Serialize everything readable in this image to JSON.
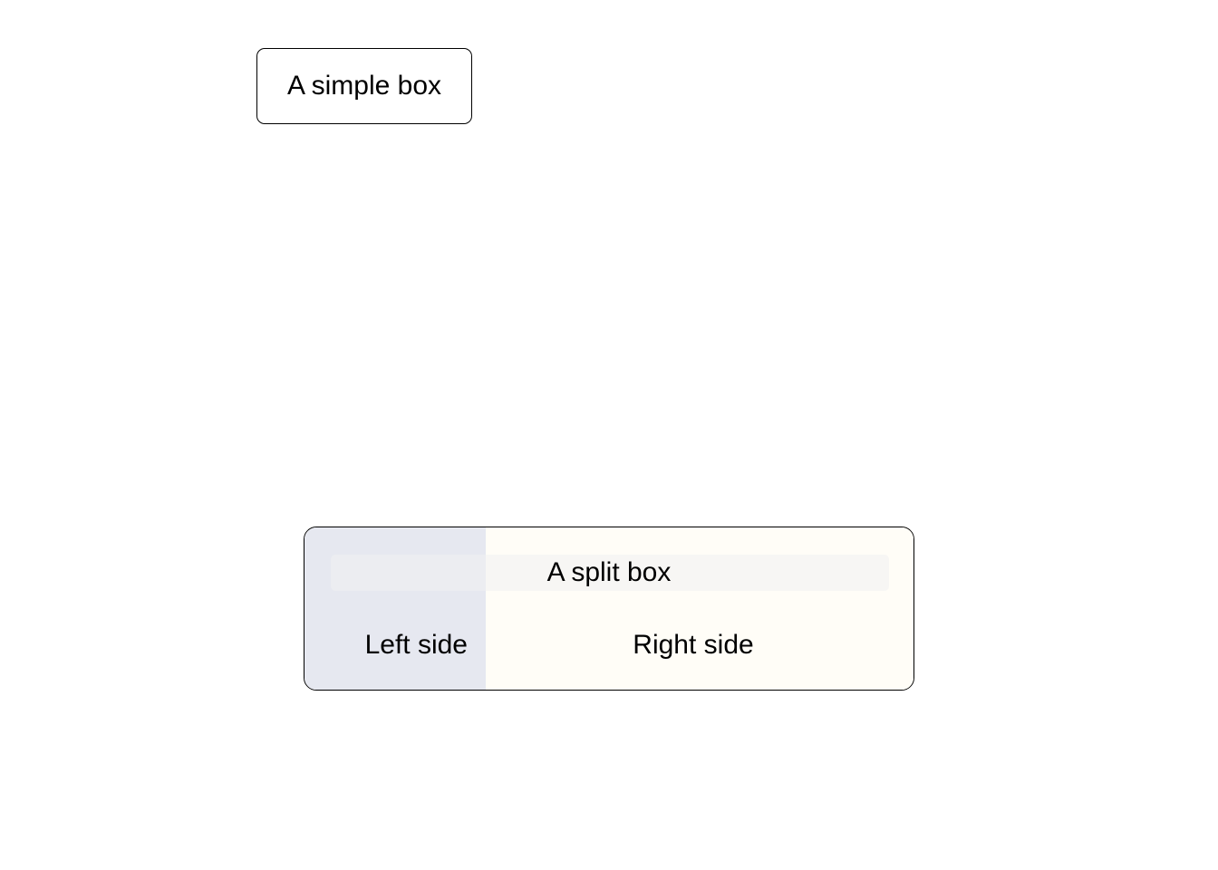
{
  "simple_box": {
    "label": "A simple box"
  },
  "split_box": {
    "title": "A split box",
    "left_label": "Left side",
    "right_label": "Right side"
  },
  "colors": {
    "background": "#ffffff",
    "border": "#000000",
    "left_fill": "#e6e8f0",
    "right_fill": "#fffdf7",
    "title_band": "#f0f0f2"
  }
}
